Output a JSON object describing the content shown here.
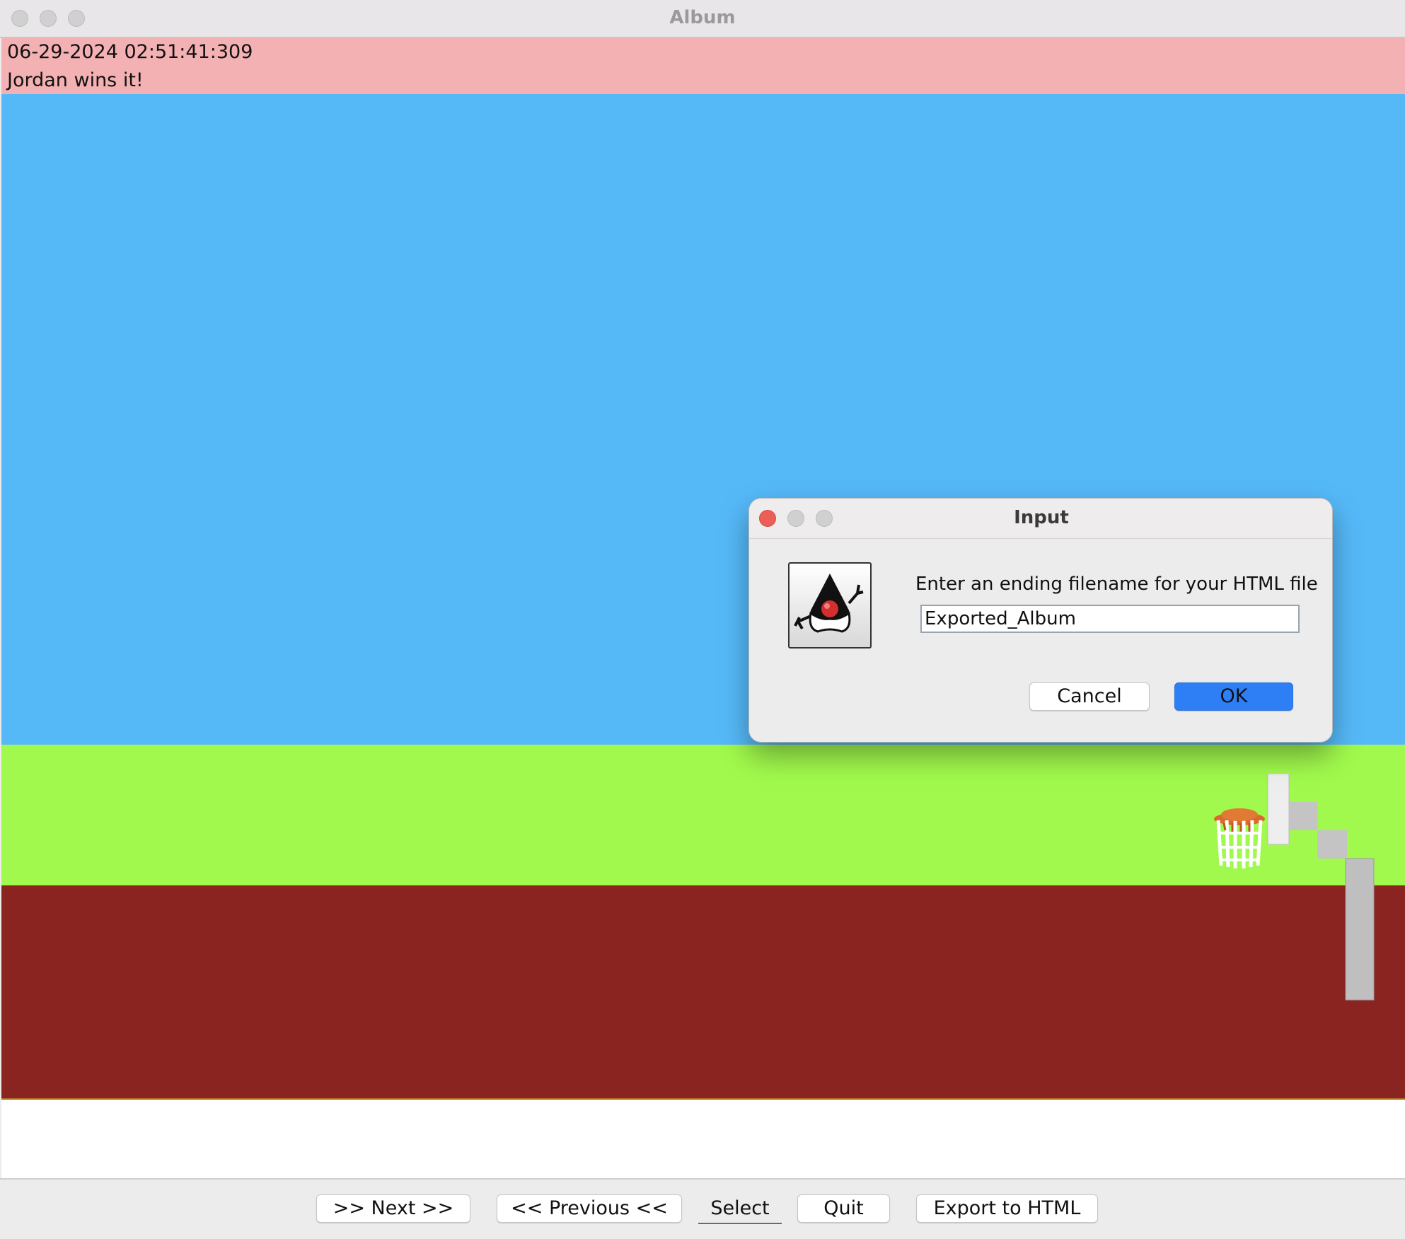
{
  "window": {
    "title": "Album"
  },
  "banner": {
    "timestamp": "06-29-2024 02:51:41:309",
    "caption": "Jordan wins it!"
  },
  "toolbar": {
    "next_label": ">> Next >>",
    "previous_label": "<< Previous <<",
    "select_label": "Select",
    "quit_label": "Quit",
    "export_label": "Export to HTML"
  },
  "dialog": {
    "title": "Input",
    "message": "Enter an ending filename for your HTML file",
    "input_value": "Exported_Album",
    "cancel_label": "Cancel",
    "ok_label": "OK",
    "icon": "java-duke-icon"
  },
  "colors": {
    "banner": "#f4b1b3",
    "sky": "#55b9f8",
    "grass": "#a0f94c",
    "court": "#8a2421",
    "ok_button": "#2e7ff5"
  }
}
